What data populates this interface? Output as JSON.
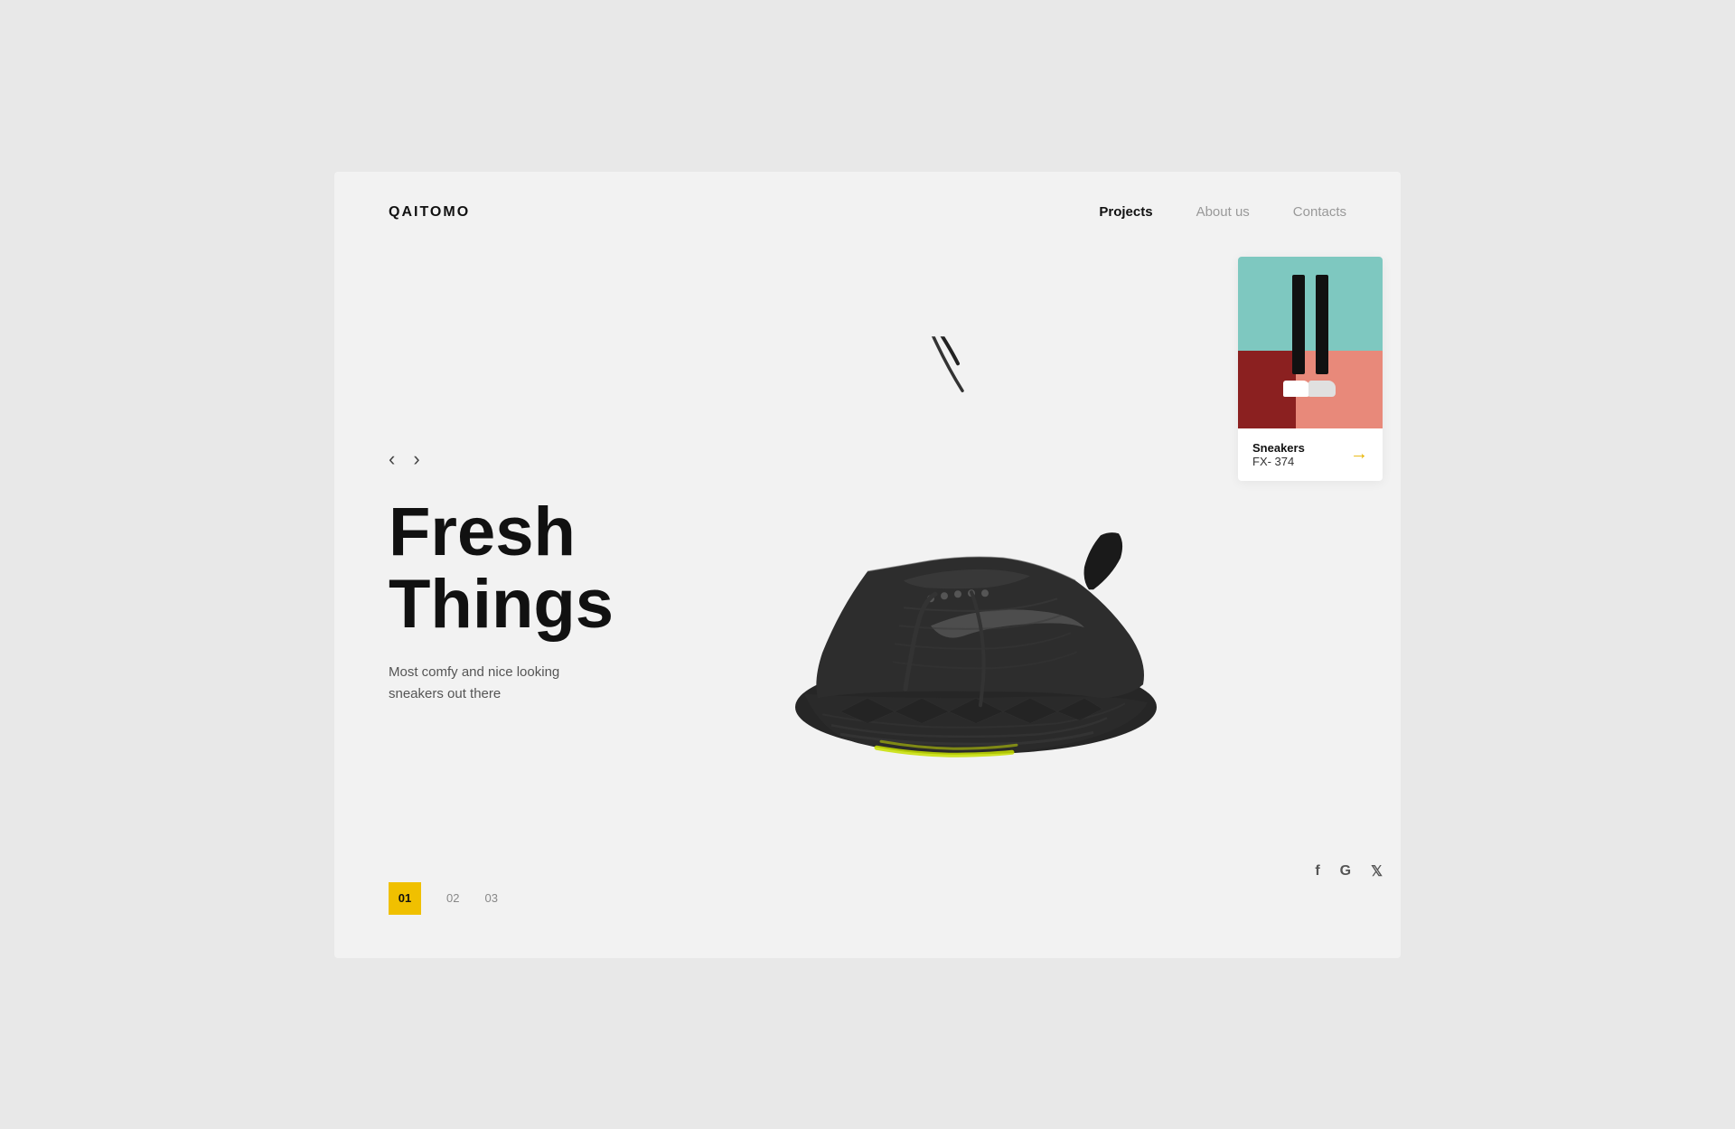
{
  "brand": {
    "logo": "QAITOMO"
  },
  "nav": {
    "items": [
      {
        "label": "Projects",
        "active": true
      },
      {
        "label": "About us",
        "active": false
      },
      {
        "label": "Contacts",
        "active": false
      }
    ]
  },
  "hero": {
    "title_line1": "Fresh",
    "title_line2": "Things",
    "description": "Most comfy and nice looking sneakers out there",
    "prev_arrow": "‹",
    "next_arrow": "›"
  },
  "product_card": {
    "name": "Sneakers",
    "model": "FX- 374",
    "arrow": "→"
  },
  "pagination": {
    "items": [
      {
        "label": "01",
        "active": true
      },
      {
        "label": "02",
        "active": false
      },
      {
        "label": "03",
        "active": false
      }
    ]
  },
  "social": {
    "icons": [
      {
        "label": "f",
        "name": "facebook"
      },
      {
        "label": "G",
        "name": "google"
      },
      {
        "label": "𝕏",
        "name": "twitter"
      }
    ]
  }
}
